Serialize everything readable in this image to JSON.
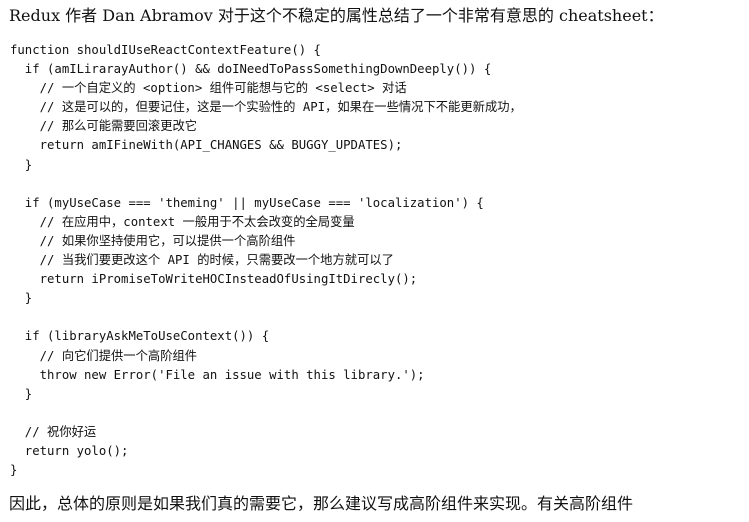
{
  "intro_text": "Redux 作者 Dan Abramov 对于这个不稳定的属性总结了一个非常有意思的 cheatsheet：",
  "code_lines": [
    "function shouldIUseReactContextFeature() {",
    "  if (amILirarayAuthor() && doINeedToPassSomethingDownDeeply()) {",
    "    // 一个自定义的 <option> 组件可能想与它的 <select> 对话",
    "    // 这是可以的，但要记住，这是一个实验性的 API，如果在一些情况下不能更新成功，",
    "    // 那么可能需要回滚更改它",
    "    return amIFineWith(API_CHANGES && BUGGY_UPDATES);",
    "  }",
    "",
    "  if (myUseCase === 'theming' || myUseCase === 'localization') {",
    "    // 在应用中，context 一般用于不太会改变的全局变量",
    "    // 如果你坚持使用它，可以提供一个高阶组件",
    "    // 当我们要更改这个 API 的时候，只需要改一个地方就可以了",
    "    return iPromiseToWriteHOCInsteadOfUsingItDirecly();",
    "  }",
    "",
    "  if (libraryAskMeToUseContext()) {",
    "    // 向它们提供一个高阶组件",
    "    throw new Error('File an issue with this library.');",
    "  }",
    "",
    "  // 祝你好运",
    "  return yolo();",
    "}"
  ],
  "outro_text": "因此，总体的原则是如果我们真的需要它，那么建议写成高阶组件来实现。有关高阶组件"
}
